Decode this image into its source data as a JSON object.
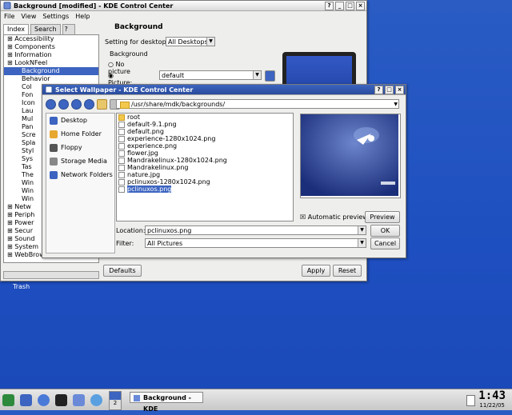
{
  "desktop": {
    "trash_label": "Trash"
  },
  "main_window": {
    "title": "Background [modified] - KDE Control Center",
    "menu": [
      "File",
      "View",
      "Settings",
      "Help"
    ],
    "tabs": [
      "Index",
      "Search"
    ],
    "tree": [
      {
        "label": "Accessibility",
        "level": 1
      },
      {
        "label": "Components",
        "level": 1
      },
      {
        "label": "Information",
        "level": 1
      },
      {
        "label": "LookNFeel",
        "level": 1
      },
      {
        "label": "Background",
        "level": 2,
        "selected": true
      },
      {
        "label": "Behavior",
        "level": 2
      },
      {
        "label": "Col",
        "level": 2
      },
      {
        "label": "Fon",
        "level": 2
      },
      {
        "label": "Icon",
        "level": 2
      },
      {
        "label": "Lau",
        "level": 2
      },
      {
        "label": "Mul",
        "level": 2
      },
      {
        "label": "Pan",
        "level": 2
      },
      {
        "label": "Scre",
        "level": 2
      },
      {
        "label": "Spla",
        "level": 2
      },
      {
        "label": "Styl",
        "level": 2
      },
      {
        "label": "Sys",
        "level": 2
      },
      {
        "label": "Tas",
        "level": 2
      },
      {
        "label": "The",
        "level": 2
      },
      {
        "label": "Win",
        "level": 2
      },
      {
        "label": "Win",
        "level": 2
      },
      {
        "label": "Win",
        "level": 2
      },
      {
        "label": "Netw",
        "level": 1
      },
      {
        "label": "Periph",
        "level": 1
      },
      {
        "label": "Power",
        "level": 1
      },
      {
        "label": "Secur",
        "level": 1
      },
      {
        "label": "Sound",
        "level": 1
      },
      {
        "label": "System",
        "level": 1
      },
      {
        "label": "WebBrowsing",
        "level": 1
      }
    ],
    "pane_title": "Background",
    "setting_for_label": "Setting for desktop:",
    "setting_for_value": "All Desktops",
    "background_group": "Background",
    "no_picture": "No picture",
    "picture_label": "Picture:",
    "picture_value": "default",
    "defaults_button": "Defaults",
    "apply_button": "Apply",
    "reset_button": "Reset"
  },
  "dialog": {
    "title": "Select Wallpaper - KDE Control Center",
    "path": "/usr/share/mdk/backgrounds/",
    "places": [
      "Desktop",
      "Home Folder",
      "Floppy",
      "Storage Media",
      "Network Folders"
    ],
    "files": [
      {
        "name": "root",
        "type": "folder"
      },
      {
        "name": "default-9.1.png",
        "type": "file"
      },
      {
        "name": "default.png",
        "type": "file"
      },
      {
        "name": "experience-1280x1024.png",
        "type": "file"
      },
      {
        "name": "experience.png",
        "type": "file"
      },
      {
        "name": "flower.jpg",
        "type": "file"
      },
      {
        "name": "Mandrakelinux-1280x1024.png",
        "type": "file"
      },
      {
        "name": "Mandrakelinux.png",
        "type": "file"
      },
      {
        "name": "nature.jpg",
        "type": "file"
      },
      {
        "name": "pclinuxos-1280x1024.png",
        "type": "file"
      },
      {
        "name": "pclinuxos.png",
        "type": "file",
        "selected": true
      }
    ],
    "automatic_preview_label": "Automatic preview",
    "automatic_preview_checked": true,
    "preview_button": "Preview",
    "location_label": "Location:",
    "location_value": "pclinuxos.png",
    "filter_label": "Filter:",
    "filter_value": "All Pictures",
    "ok_button": "OK",
    "cancel_button": "Cancel"
  },
  "taskbar": {
    "desktop_number": "2",
    "task_label": "Background - KDE",
    "time": "1:43",
    "date": "11/22/05"
  }
}
